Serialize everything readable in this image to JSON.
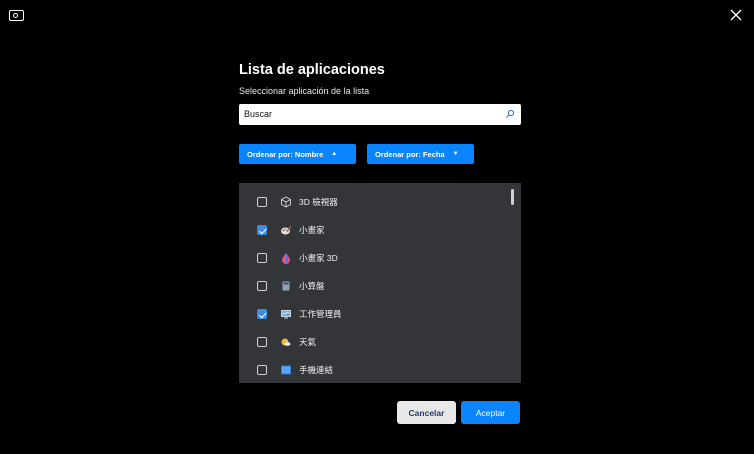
{
  "window": {
    "close_icon": "close-icon",
    "app_icon": "monitor-icon"
  },
  "dialog": {
    "title": "Lista de aplicaciones",
    "subtitle": "Seleccionar aplicación de la lista",
    "search": {
      "value": "Buscar",
      "icon": "search-icon"
    },
    "sort_by_name": "Ordenar por: Nombre",
    "sort_by_date": "Ordenar por: Fecha",
    "apps": [
      {
        "name": "3D 檢視器",
        "checked": false,
        "icon": "cube-icon"
      },
      {
        "name": "小畫家",
        "checked": true,
        "icon": "paint-icon"
      },
      {
        "name": "小畫家 3D",
        "checked": false,
        "icon": "paint3d-icon"
      },
      {
        "name": "小算盤",
        "checked": false,
        "icon": "calculator-icon"
      },
      {
        "name": "工作管理員",
        "checked": true,
        "icon": "task-manager-icon"
      },
      {
        "name": "天氣",
        "checked": false,
        "icon": "weather-icon"
      },
      {
        "name": "手機連結",
        "checked": false,
        "icon": "phone-link-icon"
      }
    ],
    "cancel_label": "Cancelar",
    "accept_label": "Aceptar"
  },
  "colors": {
    "accent": "#0a84ff",
    "list_bg": "#333538",
    "background": "#000000"
  }
}
